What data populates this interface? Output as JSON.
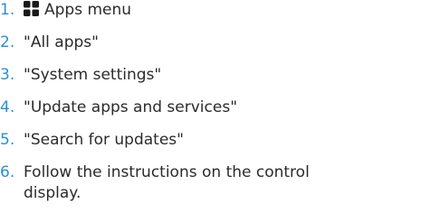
{
  "steps": [
    {
      "number": "1.",
      "icon": "apps-grid-icon",
      "text": "Apps menu"
    },
    {
      "number": "2.",
      "text": "\"All apps\""
    },
    {
      "number": "3.",
      "text": "\"System settings\""
    },
    {
      "number": "4.",
      "text": "\"Update apps and services\""
    },
    {
      "number": "5.",
      "text": "\"Search for updates\""
    },
    {
      "number": "6.",
      "text": "Follow the instructions on the control display."
    }
  ],
  "colors": {
    "number": "#2a8fd6",
    "text": "#2b2b2b",
    "icon": "#1a1a1a"
  }
}
